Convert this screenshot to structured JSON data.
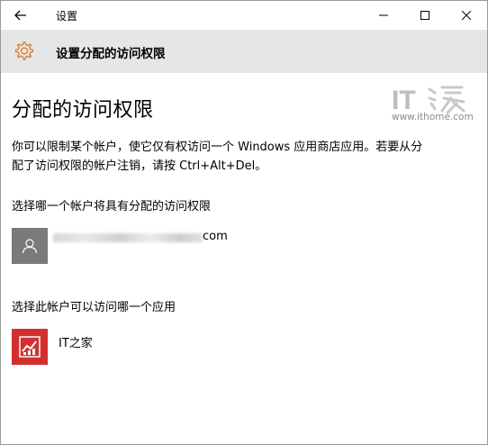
{
  "window": {
    "title": "设置"
  },
  "header": {
    "title": "设置分配的访问权限"
  },
  "page": {
    "heading": "分配的访问权限",
    "description": "你可以限制某个帐户，使它仅有权访问一个 Windows 应用商店应用。若要从分配了访问权限的帐户注销，请按 Ctrl+Alt+Del。",
    "account_section_label": "选择哪一个帐户将具有分配的访问权限",
    "account_visible_suffix": "com",
    "app_section_label": "选择此帐户可以访问哪一个应用",
    "app_name": "IT之家"
  },
  "watermark": {
    "logo_text": "IT",
    "url": "www.ithome.com"
  },
  "colors": {
    "header_bg": "#e6e6e6",
    "avatar_bg": "#7a7a7a",
    "app_icon_bg": "#d32f2f",
    "gear_color": "#d97a2b"
  },
  "icons": {
    "back": "back-arrow-icon",
    "settings": "gear-icon",
    "minimize": "minimize-icon",
    "maximize": "maximize-icon",
    "close": "close-icon",
    "avatar": "user-icon",
    "app": "chart-icon"
  }
}
